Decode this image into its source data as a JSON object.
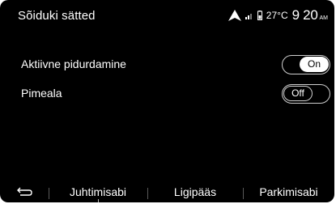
{
  "header": {
    "title": "Sõiduki sätted",
    "status": {
      "nav_icon": "navigation-arrow-icon",
      "signal_icon": "signal-bars-icon",
      "battery_icon": "phone-battery-icon",
      "temperature": "27°C",
      "time": "9 20",
      "ampm": "AM"
    }
  },
  "settings": [
    {
      "label": "Aktiivne pidurdamine",
      "state": "On"
    },
    {
      "label": "Pimeala",
      "state": "Off"
    }
  ],
  "tabbar": {
    "back_icon": "back-arrow-icon",
    "tabs": [
      {
        "label": "Juhtimisabi",
        "selected": true
      },
      {
        "label": "Ligipääs",
        "selected": false
      },
      {
        "label": "Parkimisabi",
        "selected": false
      }
    ]
  }
}
